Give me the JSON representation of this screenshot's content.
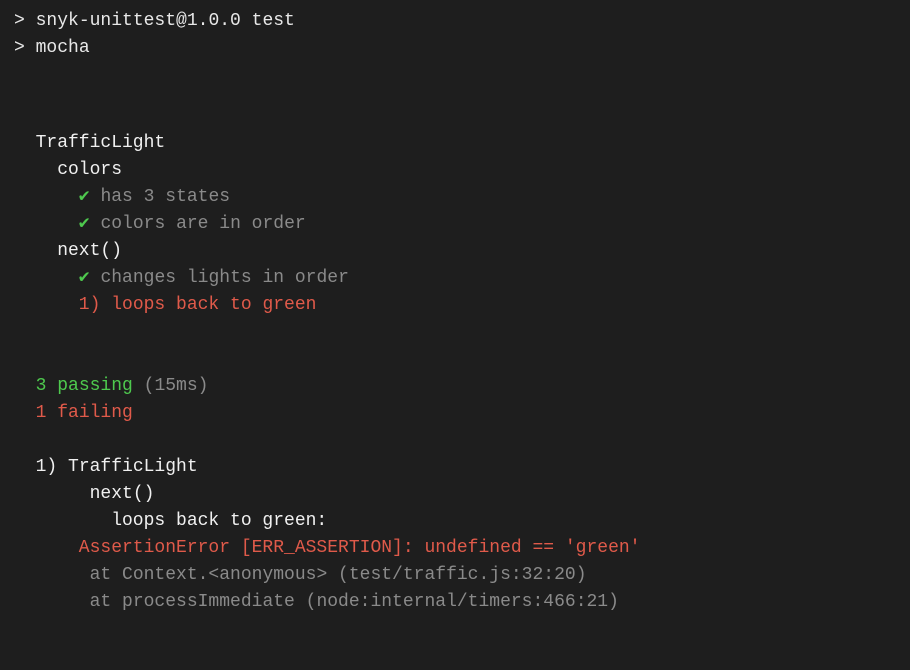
{
  "header": {
    "line1_prefix": "> ",
    "line1_text": "snyk-unittest@1.0.0 test",
    "line2_prefix": "> ",
    "line2_text": "mocha"
  },
  "suite": {
    "root": "TrafficLight",
    "group1": "colors",
    "test1": "has 3 states",
    "test2": "colors are in order",
    "group2": "next()",
    "test3": "changes lights in order",
    "fail_num": "1)",
    "fail_text": "loops back to green",
    "check": "✔"
  },
  "summary": {
    "passing_count": "3",
    "passing_label": "passing",
    "passing_time": "(15ms)",
    "failing_count": "1",
    "failing_label": "failing"
  },
  "failure": {
    "num": "1)",
    "suite": "TrafficLight",
    "group": "next()",
    "test": "loops back to green:",
    "error": "AssertionError [ERR_ASSERTION]: undefined == 'green'",
    "stack1": "at Context.<anonymous> (test/traffic.js:32:20)",
    "stack2": "at processImmediate (node:internal/timers:466:21)"
  }
}
